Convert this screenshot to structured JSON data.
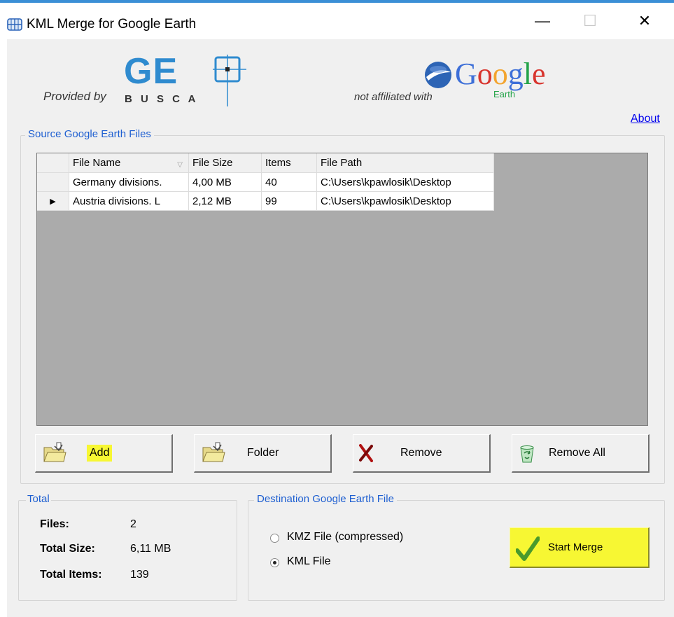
{
  "window": {
    "title": "KML Merge for Google Earth",
    "controls": {
      "minimize": "—",
      "maximize": "☐",
      "close": "✕"
    }
  },
  "header": {
    "provided_by": "Provided by",
    "geo_logo": "GE",
    "geo_sub": "B U S C A",
    "not_affiliated": "not affiliated with",
    "google": [
      "G",
      "o",
      "o",
      "g",
      "l",
      "e"
    ],
    "google_colors": [
      "#3d6fd8",
      "#d8352e",
      "#f3a42f",
      "#3d6fd8",
      "#23a348",
      "#d8352e"
    ],
    "earth": "Earth",
    "about": "About"
  },
  "source": {
    "legend": "Source Google Earth Files",
    "columns": [
      "File Name",
      "File Size",
      "Items",
      "File Path"
    ],
    "rows": [
      {
        "marker": "",
        "name": "Germany divisions.",
        "size": "4,00 MB",
        "items": "40",
        "path": "C:\\Users\\kpawlosik\\Desktop"
      },
      {
        "marker": "▶",
        "name": "Austria divisions. L",
        "size": "2,12 MB",
        "items": "99",
        "path": "C:\\Users\\kpawlosik\\Desktop"
      }
    ]
  },
  "buttons": {
    "add": "Add",
    "folder": "Folder",
    "remove": "Remove",
    "remove_all": "Remove All"
  },
  "total": {
    "legend": "Total",
    "files_label": "Files:",
    "files": "2",
    "size_label": "Total Size:",
    "size": "6,11 MB",
    "items_label": "Total Items:",
    "items": "139"
  },
  "destination": {
    "legend": "Destination Google Earth File",
    "kmz": "KMZ File (compressed)",
    "kml": "KML File",
    "selected": "kml",
    "start": "Start Merge"
  },
  "colors": {
    "legend_blue": "#1e5fd1",
    "highlight": "#f7f733",
    "geo_blue": "#2f8bcf",
    "grid_bg": "#ababab"
  }
}
